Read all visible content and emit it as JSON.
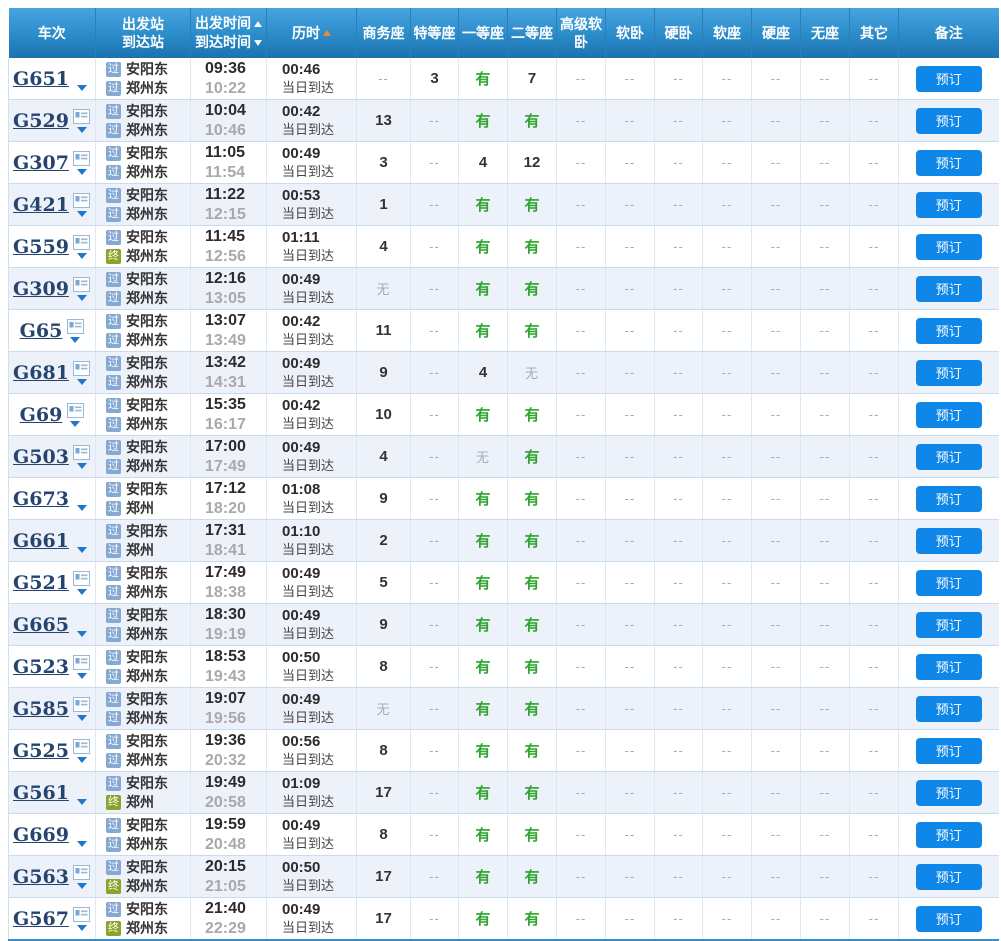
{
  "labels": {
    "book": "预订",
    "pass_tag": "过",
    "terminal_tag": "终"
  },
  "header": {
    "train": "车次",
    "station_top": "出发站",
    "station_bottom": "到达站",
    "time_top": "出发时间",
    "time_bottom": "到达时间",
    "duration": "历时",
    "seat_cols": [
      "商务座",
      "特等座",
      "一等座",
      "二等座",
      "高级软卧",
      "软卧",
      "硬卧",
      "软座",
      "硬座",
      "无座",
      "其它"
    ],
    "remark": "备注"
  },
  "colors": {
    "header_blue": "#2b8bc9",
    "accent_button": "#0f87e8",
    "available_green": "#2da42c",
    "sort_arrow_orange": "#ef8a2c",
    "pass_tag_blue": "#85a9d2",
    "terminal_tag_green": "#8aa32b",
    "alt_row": "#edf1f9"
  },
  "trains": [
    {
      "no": "G651",
      "id_card": false,
      "from": {
        "tag": "过",
        "name": "安阳东"
      },
      "to": {
        "tag": "过",
        "name": "郑州东"
      },
      "depart": "09:36",
      "arrive": "10:22",
      "duration": "00:46",
      "arrive_note": "当日到达",
      "seats": [
        "--",
        "3",
        "有",
        "7",
        "--",
        "--",
        "--",
        "--",
        "--",
        "--",
        "--"
      ]
    },
    {
      "no": "G529",
      "id_card": true,
      "from": {
        "tag": "过",
        "name": "安阳东"
      },
      "to": {
        "tag": "过",
        "name": "郑州东"
      },
      "depart": "10:04",
      "arrive": "10:46",
      "duration": "00:42",
      "arrive_note": "当日到达",
      "seats": [
        "13",
        "--",
        "有",
        "有",
        "--",
        "--",
        "--",
        "--",
        "--",
        "--",
        "--"
      ]
    },
    {
      "no": "G307",
      "id_card": true,
      "from": {
        "tag": "过",
        "name": "安阳东"
      },
      "to": {
        "tag": "过",
        "name": "郑州东"
      },
      "depart": "11:05",
      "arrive": "11:54",
      "duration": "00:49",
      "arrive_note": "当日到达",
      "seats": [
        "3",
        "--",
        "4",
        "12",
        "--",
        "--",
        "--",
        "--",
        "--",
        "--",
        "--"
      ]
    },
    {
      "no": "G421",
      "id_card": true,
      "from": {
        "tag": "过",
        "name": "安阳东"
      },
      "to": {
        "tag": "过",
        "name": "郑州东"
      },
      "depart": "11:22",
      "arrive": "12:15",
      "duration": "00:53",
      "arrive_note": "当日到达",
      "seats": [
        "1",
        "--",
        "有",
        "有",
        "--",
        "--",
        "--",
        "--",
        "--",
        "--",
        "--"
      ]
    },
    {
      "no": "G559",
      "id_card": true,
      "from": {
        "tag": "过",
        "name": "安阳东"
      },
      "to": {
        "tag": "终",
        "name": "郑州东"
      },
      "depart": "11:45",
      "arrive": "12:56",
      "duration": "01:11",
      "arrive_note": "当日到达",
      "seats": [
        "4",
        "--",
        "有",
        "有",
        "--",
        "--",
        "--",
        "--",
        "--",
        "--",
        "--"
      ]
    },
    {
      "no": "G309",
      "id_card": true,
      "from": {
        "tag": "过",
        "name": "安阳东"
      },
      "to": {
        "tag": "过",
        "name": "郑州东"
      },
      "depart": "12:16",
      "arrive": "13:05",
      "duration": "00:49",
      "arrive_note": "当日到达",
      "seats": [
        "无",
        "--",
        "有",
        "有",
        "--",
        "--",
        "--",
        "--",
        "--",
        "--",
        "--"
      ]
    },
    {
      "no": "G65",
      "id_card": true,
      "from": {
        "tag": "过",
        "name": "安阳东"
      },
      "to": {
        "tag": "过",
        "name": "郑州东"
      },
      "depart": "13:07",
      "arrive": "13:49",
      "duration": "00:42",
      "arrive_note": "当日到达",
      "seats": [
        "11",
        "--",
        "有",
        "有",
        "--",
        "--",
        "--",
        "--",
        "--",
        "--",
        "--"
      ]
    },
    {
      "no": "G681",
      "id_card": true,
      "from": {
        "tag": "过",
        "name": "安阳东"
      },
      "to": {
        "tag": "过",
        "name": "郑州东"
      },
      "depart": "13:42",
      "arrive": "14:31",
      "duration": "00:49",
      "arrive_note": "当日到达",
      "seats": [
        "9",
        "--",
        "4",
        "无",
        "--",
        "--",
        "--",
        "--",
        "--",
        "--",
        "--"
      ]
    },
    {
      "no": "G69",
      "id_card": true,
      "from": {
        "tag": "过",
        "name": "安阳东"
      },
      "to": {
        "tag": "过",
        "name": "郑州东"
      },
      "depart": "15:35",
      "arrive": "16:17",
      "duration": "00:42",
      "arrive_note": "当日到达",
      "seats": [
        "10",
        "--",
        "有",
        "有",
        "--",
        "--",
        "--",
        "--",
        "--",
        "--",
        "--"
      ]
    },
    {
      "no": "G503",
      "id_card": true,
      "from": {
        "tag": "过",
        "name": "安阳东"
      },
      "to": {
        "tag": "过",
        "name": "郑州东"
      },
      "depart": "17:00",
      "arrive": "17:49",
      "duration": "00:49",
      "arrive_note": "当日到达",
      "seats": [
        "4",
        "--",
        "无",
        "有",
        "--",
        "--",
        "--",
        "--",
        "--",
        "--",
        "--"
      ]
    },
    {
      "no": "G673",
      "id_card": false,
      "from": {
        "tag": "过",
        "name": "安阳东"
      },
      "to": {
        "tag": "过",
        "name": "郑州"
      },
      "depart": "17:12",
      "arrive": "18:20",
      "duration": "01:08",
      "arrive_note": "当日到达",
      "seats": [
        "9",
        "--",
        "有",
        "有",
        "--",
        "--",
        "--",
        "--",
        "--",
        "--",
        "--"
      ]
    },
    {
      "no": "G661",
      "id_card": false,
      "from": {
        "tag": "过",
        "name": "安阳东"
      },
      "to": {
        "tag": "过",
        "name": "郑州"
      },
      "depart": "17:31",
      "arrive": "18:41",
      "duration": "01:10",
      "arrive_note": "当日到达",
      "seats": [
        "2",
        "--",
        "有",
        "有",
        "--",
        "--",
        "--",
        "--",
        "--",
        "--",
        "--"
      ]
    },
    {
      "no": "G521",
      "id_card": true,
      "from": {
        "tag": "过",
        "name": "安阳东"
      },
      "to": {
        "tag": "过",
        "name": "郑州东"
      },
      "depart": "17:49",
      "arrive": "18:38",
      "duration": "00:49",
      "arrive_note": "当日到达",
      "seats": [
        "5",
        "--",
        "有",
        "有",
        "--",
        "--",
        "--",
        "--",
        "--",
        "--",
        "--"
      ]
    },
    {
      "no": "G665",
      "id_card": false,
      "from": {
        "tag": "过",
        "name": "安阳东"
      },
      "to": {
        "tag": "过",
        "name": "郑州东"
      },
      "depart": "18:30",
      "arrive": "19:19",
      "duration": "00:49",
      "arrive_note": "当日到达",
      "seats": [
        "9",
        "--",
        "有",
        "有",
        "--",
        "--",
        "--",
        "--",
        "--",
        "--",
        "--"
      ]
    },
    {
      "no": "G523",
      "id_card": true,
      "from": {
        "tag": "过",
        "name": "安阳东"
      },
      "to": {
        "tag": "过",
        "name": "郑州东"
      },
      "depart": "18:53",
      "arrive": "19:43",
      "duration": "00:50",
      "arrive_note": "当日到达",
      "seats": [
        "8",
        "--",
        "有",
        "有",
        "--",
        "--",
        "--",
        "--",
        "--",
        "--",
        "--"
      ]
    },
    {
      "no": "G585",
      "id_card": true,
      "from": {
        "tag": "过",
        "name": "安阳东"
      },
      "to": {
        "tag": "过",
        "name": "郑州东"
      },
      "depart": "19:07",
      "arrive": "19:56",
      "duration": "00:49",
      "arrive_note": "当日到达",
      "seats": [
        "无",
        "--",
        "有",
        "有",
        "--",
        "--",
        "--",
        "--",
        "--",
        "--",
        "--"
      ]
    },
    {
      "no": "G525",
      "id_card": true,
      "from": {
        "tag": "过",
        "name": "安阳东"
      },
      "to": {
        "tag": "过",
        "name": "郑州东"
      },
      "depart": "19:36",
      "arrive": "20:32",
      "duration": "00:56",
      "arrive_note": "当日到达",
      "seats": [
        "8",
        "--",
        "有",
        "有",
        "--",
        "--",
        "--",
        "--",
        "--",
        "--",
        "--"
      ]
    },
    {
      "no": "G561",
      "id_card": false,
      "from": {
        "tag": "过",
        "name": "安阳东"
      },
      "to": {
        "tag": "终",
        "name": "郑州"
      },
      "depart": "19:49",
      "arrive": "20:58",
      "duration": "01:09",
      "arrive_note": "当日到达",
      "seats": [
        "17",
        "--",
        "有",
        "有",
        "--",
        "--",
        "--",
        "--",
        "--",
        "--",
        "--"
      ]
    },
    {
      "no": "G669",
      "id_card": false,
      "from": {
        "tag": "过",
        "name": "安阳东"
      },
      "to": {
        "tag": "过",
        "name": "郑州东"
      },
      "depart": "19:59",
      "arrive": "20:48",
      "duration": "00:49",
      "arrive_note": "当日到达",
      "seats": [
        "8",
        "--",
        "有",
        "有",
        "--",
        "--",
        "--",
        "--",
        "--",
        "--",
        "--"
      ]
    },
    {
      "no": "G563",
      "id_card": true,
      "from": {
        "tag": "过",
        "name": "安阳东"
      },
      "to": {
        "tag": "终",
        "name": "郑州东"
      },
      "depart": "20:15",
      "arrive": "21:05",
      "duration": "00:50",
      "arrive_note": "当日到达",
      "seats": [
        "17",
        "--",
        "有",
        "有",
        "--",
        "--",
        "--",
        "--",
        "--",
        "--",
        "--"
      ]
    },
    {
      "no": "G567",
      "id_card": true,
      "from": {
        "tag": "过",
        "name": "安阳东"
      },
      "to": {
        "tag": "终",
        "name": "郑州东"
      },
      "depart": "21:40",
      "arrive": "22:29",
      "duration": "00:49",
      "arrive_note": "当日到达",
      "seats": [
        "17",
        "--",
        "有",
        "有",
        "--",
        "--",
        "--",
        "--",
        "--",
        "--",
        "--"
      ]
    }
  ]
}
